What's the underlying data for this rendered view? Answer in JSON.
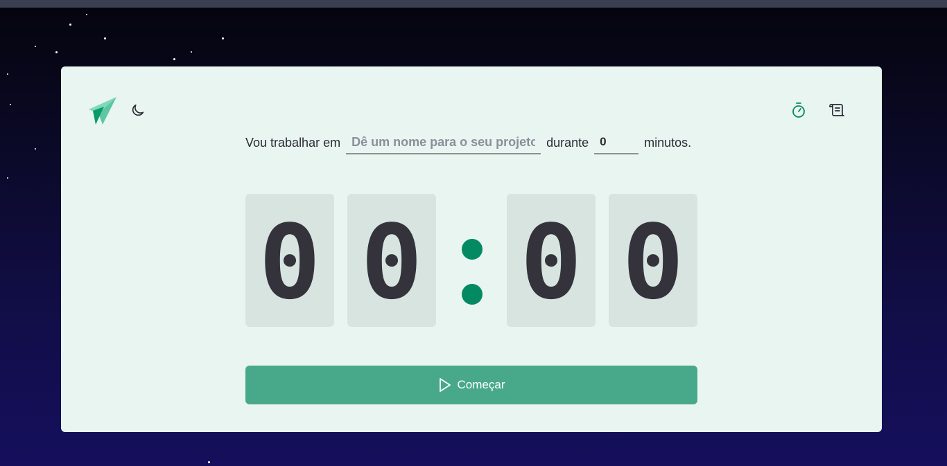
{
  "header": {
    "theme_toggle_icon": "moon-icon",
    "timer_icon": "stopwatch-icon",
    "history_icon": "scroll-icon",
    "logo_icon": "paper-plane-logo"
  },
  "form": {
    "prefix": "Vou trabalhar em",
    "project_placeholder": "Dê um nome para o seu projeto",
    "middle": "durante",
    "minutes_value": "0",
    "suffix": "minutos."
  },
  "timer": {
    "minute_tens": "0",
    "minute_ones": "0",
    "second_tens": "0",
    "second_ones": "0"
  },
  "actions": {
    "start_label": "Começar",
    "start_icon": "play-icon"
  },
  "colors": {
    "accent": "#048a63",
    "button": "#48a98a",
    "card_bg": "#e9f5f1",
    "digit_bg": "#d7e4e0",
    "digit_text": "#34323b"
  }
}
